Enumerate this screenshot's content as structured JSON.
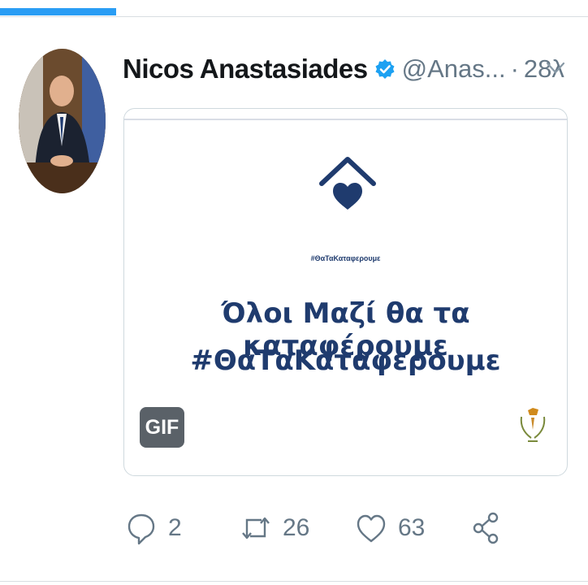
{
  "tweet": {
    "author_name": "Nicos Anastasiades",
    "handle": "@Anas...",
    "separator": "·",
    "time": "28λ",
    "media": {
      "hashtag_small": "#ΘαΤαΚαταφερουμε",
      "line1": "Όλοι Μαζί θα τα καταφέρουμε",
      "line2": "#ΘαΤαΚαταφερουμε",
      "badge": "GIF"
    },
    "actions": {
      "replies": "2",
      "retweets": "26",
      "likes": "63"
    }
  },
  "colors": {
    "accent": "#2a9df4",
    "verified": "#1da1f2",
    "brand_navy": "#1f3b6e",
    "muted": "#657786"
  },
  "icons": {
    "verified": "verified-badge-icon",
    "caret": "chevron-down-icon",
    "reply": "reply-icon",
    "retweet": "retweet-icon",
    "like": "heart-icon",
    "share": "share-icon"
  }
}
